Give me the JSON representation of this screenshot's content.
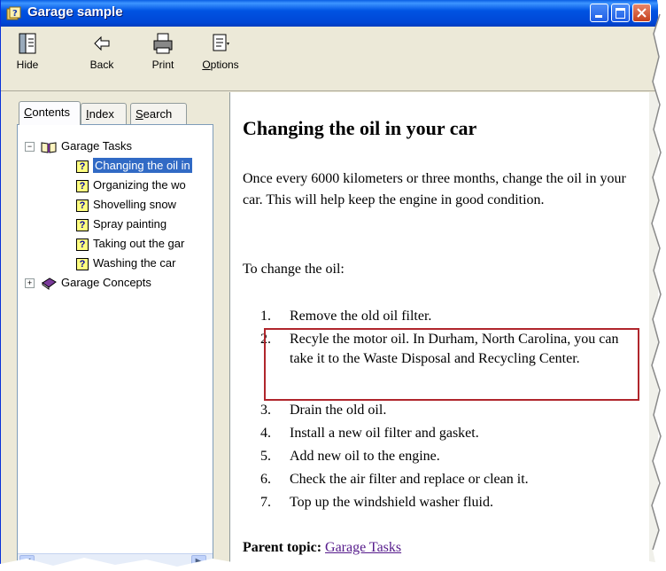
{
  "window": {
    "title": "Garage sample"
  },
  "toolbar": {
    "hide": "Hide",
    "back": "Back",
    "print": "Print",
    "options_accel": "O",
    "options_rest": "ptions"
  },
  "tabs": {
    "contents_accel": "C",
    "contents_rest": "ontents",
    "index_accel": "I",
    "index_rest": "ndex",
    "search_accel": "S",
    "search_rest": "earch"
  },
  "tree": {
    "tasks": "Garage Tasks",
    "items": [
      "Changing the oil in",
      "Organizing the wo",
      "Shovelling snow",
      "Spray painting",
      "Taking out the gar",
      "Washing the car"
    ],
    "concepts": "Garage Concepts"
  },
  "content": {
    "title": "Changing the oil in your car",
    "intro": "Once every 6000 kilometers or three months, change the oil in your car. This will help keep the engine in good condition.",
    "lead": "To change the oil:",
    "steps": [
      {
        "n": "1.",
        "t": "Remove the old oil filter."
      },
      {
        "n": "2.",
        "t": "Recyle the motor oil. In Durham, North Carolina, you can take it to the Waste Disposal and Recycling Center."
      },
      {
        "n": "3.",
        "t": "Drain the old oil."
      },
      {
        "n": "4.",
        "t": "Install a new oil filter and gasket."
      },
      {
        "n": "5.",
        "t": "Add new oil to the engine."
      },
      {
        "n": "6.",
        "t": "Check the air filter and replace or clean it."
      },
      {
        "n": "7.",
        "t": "Top up the windshield washer fluid."
      }
    ],
    "parent_label": "Parent topic:",
    "parent_link": "Garage Tasks"
  },
  "colors": {
    "highlight_border": "#b0262c",
    "selection": "#316ac5",
    "link": "#551a8b"
  }
}
